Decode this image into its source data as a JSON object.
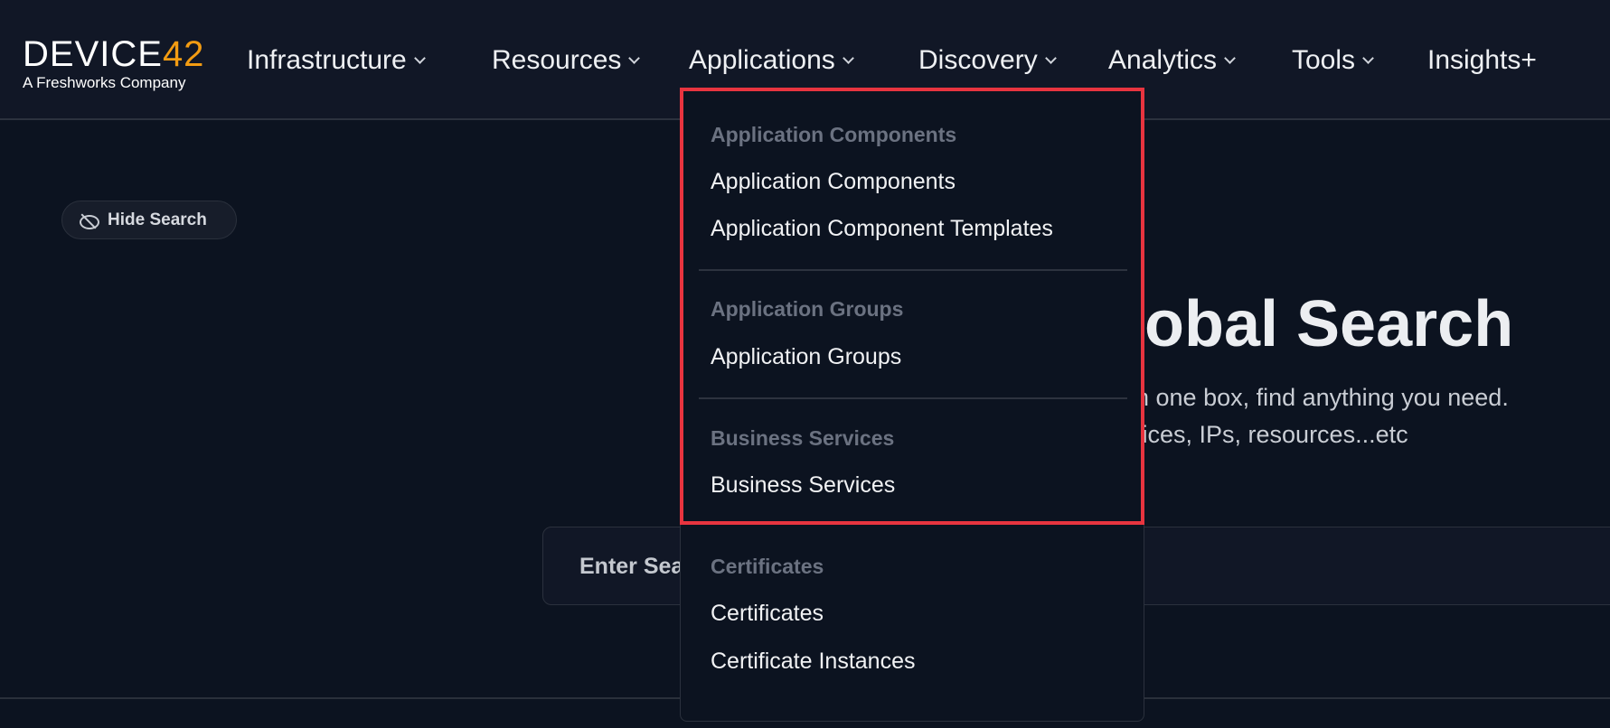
{
  "logo": {
    "brand_prefix": "DEVICE",
    "brand_number": "42",
    "tagline": "A Freshworks Company",
    "accent": "#f39c12"
  },
  "nav": [
    {
      "label": "Infrastructure",
      "has_dropdown": true
    },
    {
      "label": "Resources",
      "has_dropdown": true
    },
    {
      "label": "Applications",
      "has_dropdown": true,
      "open": true
    },
    {
      "label": "Discovery",
      "has_dropdown": true
    },
    {
      "label": "Analytics",
      "has_dropdown": true
    },
    {
      "label": "Tools",
      "has_dropdown": true
    },
    {
      "label": "Insights+",
      "has_dropdown": false
    }
  ],
  "hide_search": {
    "label": "Hide Search",
    "icon": "eye-slash-icon"
  },
  "main": {
    "title_visible": "lobal Search",
    "subtitle_line1_visible": "in one box, find anything you need.",
    "subtitle_line2_visible": "vices, IPs, resources...etc",
    "search_placeholder_visible": "Enter Sea"
  },
  "dropdown": {
    "sections": [
      {
        "header": "Application Components",
        "items": [
          "Application Components",
          "Application Component Templates"
        ]
      },
      {
        "header": "Application Groups",
        "items": [
          "Application Groups"
        ]
      },
      {
        "header": "Business Services",
        "items": [
          "Business Services"
        ]
      },
      {
        "header": "Certificates",
        "items": [
          "Certificates",
          "Certificate Instances"
        ]
      }
    ],
    "highlight_color": "#e8343f"
  }
}
